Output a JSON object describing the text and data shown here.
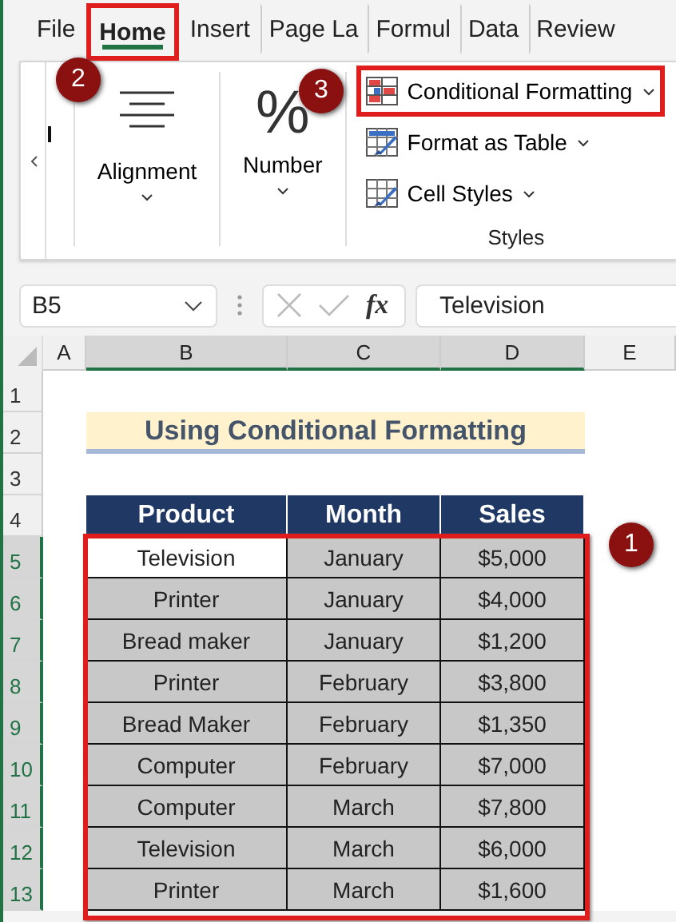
{
  "tabs": [
    {
      "label": "File",
      "selected": false,
      "highlighted": false
    },
    {
      "label": "Home",
      "selected": true,
      "highlighted": true
    },
    {
      "label": "Insert",
      "selected": false,
      "highlighted": false
    },
    {
      "label": "Page La",
      "selected": false,
      "highlighted": false
    },
    {
      "label": "Formul",
      "selected": false,
      "highlighted": false
    },
    {
      "label": "Data",
      "selected": false,
      "highlighted": false
    },
    {
      "label": "Review",
      "selected": false,
      "highlighted": false
    }
  ],
  "ribbon": {
    "groups": [
      {
        "kind": "alignment",
        "label": "Alignment"
      },
      {
        "kind": "number",
        "label": "Number",
        "glyph": "%"
      }
    ],
    "styles": {
      "label": "Styles",
      "commands": [
        {
          "kind": "conditional",
          "label": "Conditional Formatting",
          "highlighted": true
        },
        {
          "kind": "table",
          "label": "Format as Table",
          "highlighted": false
        },
        {
          "kind": "cellstyles",
          "label": "Cell Styles",
          "highlighted": false
        }
      ]
    }
  },
  "formula_bar": {
    "name_box": "B5",
    "function_label": "fx",
    "value": "Television"
  },
  "sheet": {
    "columns": [
      {
        "label": "A",
        "selected": false
      },
      {
        "label": "B",
        "selected": true
      },
      {
        "label": "C",
        "selected": true
      },
      {
        "label": "D",
        "selected": true
      },
      {
        "label": "E",
        "selected": false
      }
    ],
    "row_numbers": [
      {
        "label": "1",
        "selected": false
      },
      {
        "label": "2",
        "selected": false
      },
      {
        "label": "3",
        "selected": false
      },
      {
        "label": "4",
        "selected": false
      },
      {
        "label": "5",
        "selected": true
      },
      {
        "label": "6",
        "selected": true
      },
      {
        "label": "7",
        "selected": true
      },
      {
        "label": "8",
        "selected": true
      },
      {
        "label": "9",
        "selected": true
      },
      {
        "label": "10",
        "selected": true
      },
      {
        "label": "11",
        "selected": true
      },
      {
        "label": "12",
        "selected": true
      },
      {
        "label": "13",
        "selected": true
      }
    ],
    "title": "Using Conditional Formatting",
    "table": {
      "highlighted": true,
      "columns": [
        "Product",
        "Month",
        "Sales"
      ],
      "rows": [
        {
          "cells": [
            {
              "text": "Television",
              "selected": false
            },
            {
              "text": "January",
              "selected": true
            },
            {
              "text": "$5,000",
              "selected": true
            }
          ]
        },
        {
          "cells": [
            {
              "text": "Printer",
              "selected": true
            },
            {
              "text": "January",
              "selected": true
            },
            {
              "text": "$4,000",
              "selected": true
            }
          ]
        },
        {
          "cells": [
            {
              "text": "Bread maker",
              "selected": true
            },
            {
              "text": "January",
              "selected": true
            },
            {
              "text": "$1,200",
              "selected": true
            }
          ]
        },
        {
          "cells": [
            {
              "text": "Printer",
              "selected": true
            },
            {
              "text": "February",
              "selected": true
            },
            {
              "text": "$3,800",
              "selected": true
            }
          ]
        },
        {
          "cells": [
            {
              "text": "Bread Maker",
              "selected": true
            },
            {
              "text": "February",
              "selected": true
            },
            {
              "text": "$1,350",
              "selected": true
            }
          ]
        },
        {
          "cells": [
            {
              "text": "Computer",
              "selected": true
            },
            {
              "text": "February",
              "selected": true
            },
            {
              "text": "$7,000",
              "selected": true
            }
          ]
        },
        {
          "cells": [
            {
              "text": "Computer",
              "selected": true
            },
            {
              "text": "March",
              "selected": true
            },
            {
              "text": "$7,800",
              "selected": true
            }
          ]
        },
        {
          "cells": [
            {
              "text": "Television",
              "selected": true
            },
            {
              "text": "March",
              "selected": true
            },
            {
              "text": "$6,000",
              "selected": true
            }
          ]
        },
        {
          "cells": [
            {
              "text": "Printer",
              "selected": true
            },
            {
              "text": "March",
              "selected": true
            },
            {
              "text": "$1,600",
              "selected": true
            }
          ]
        }
      ]
    }
  },
  "callouts": [
    {
      "label": "2"
    },
    {
      "label": "3"
    },
    {
      "label": "1"
    }
  ]
}
